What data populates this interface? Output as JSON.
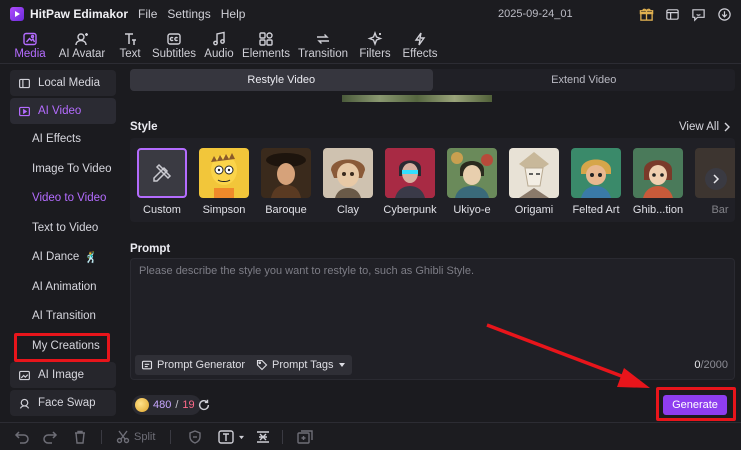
{
  "app": {
    "name": "HitPaw Edimakor",
    "menu": [
      "File",
      "Settings",
      "Help"
    ],
    "project_title": "2025-09-24_01",
    "title_icons": [
      "gift-icon",
      "layout-icon",
      "feedback-icon",
      "download-icon"
    ]
  },
  "toolbar": {
    "tabs": [
      {
        "label": "Media",
        "icon": "media-icon"
      },
      {
        "label": "AI Avatar",
        "icon": "ai-avatar-icon"
      },
      {
        "label": "Text",
        "icon": "text-icon"
      },
      {
        "label": "Subtitles",
        "icon": "subtitles-icon"
      },
      {
        "label": "Audio",
        "icon": "audio-icon"
      },
      {
        "label": "Elements",
        "icon": "elements-icon"
      },
      {
        "label": "Transition",
        "icon": "transition-icon"
      },
      {
        "label": "Filters",
        "icon": "filters-icon"
      },
      {
        "label": "Effects",
        "icon": "effects-icon"
      }
    ],
    "active": "Media"
  },
  "sidebar": {
    "local_media": "Local Media",
    "ai_video": "AI Video",
    "items": [
      "AI Effects",
      "Image To Video",
      "Video to Video",
      "Text to Video",
      "AI Dance",
      "AI Animation",
      "AI Transition",
      "My Creations"
    ],
    "selected": "Video to Video",
    "ai_image": "AI Image",
    "face_swap": "Face Swap"
  },
  "main": {
    "tabs": [
      "Restyle Video",
      "Extend Video"
    ],
    "active_tab": "Restyle Video",
    "style_title": "Style",
    "view_all": "View All",
    "styles": [
      "Custom",
      "Simpson",
      "Baroque",
      "Clay",
      "Cyberpunk",
      "Ukiyo-e",
      "Origami",
      "Felted Art",
      "Ghib...tion",
      "Bar"
    ],
    "prompt_title": "Prompt",
    "prompt_placeholder": "Please describe the style you want to restyle to, such as Ghibli Style.",
    "prompt_generator": "Prompt Generator",
    "prompt_tags": "Prompt Tags",
    "char_count": "0",
    "char_max": "/2000",
    "credits_available": "480",
    "credits_slash": "/",
    "credits_cost": "19",
    "generate_label": "Generate"
  },
  "bottombar": {
    "split_label": "Split"
  },
  "colors": {
    "accent": "#b46cff",
    "generate": "#8e3df0",
    "annotation": "#e8151b",
    "background": "#1b1b1f"
  }
}
